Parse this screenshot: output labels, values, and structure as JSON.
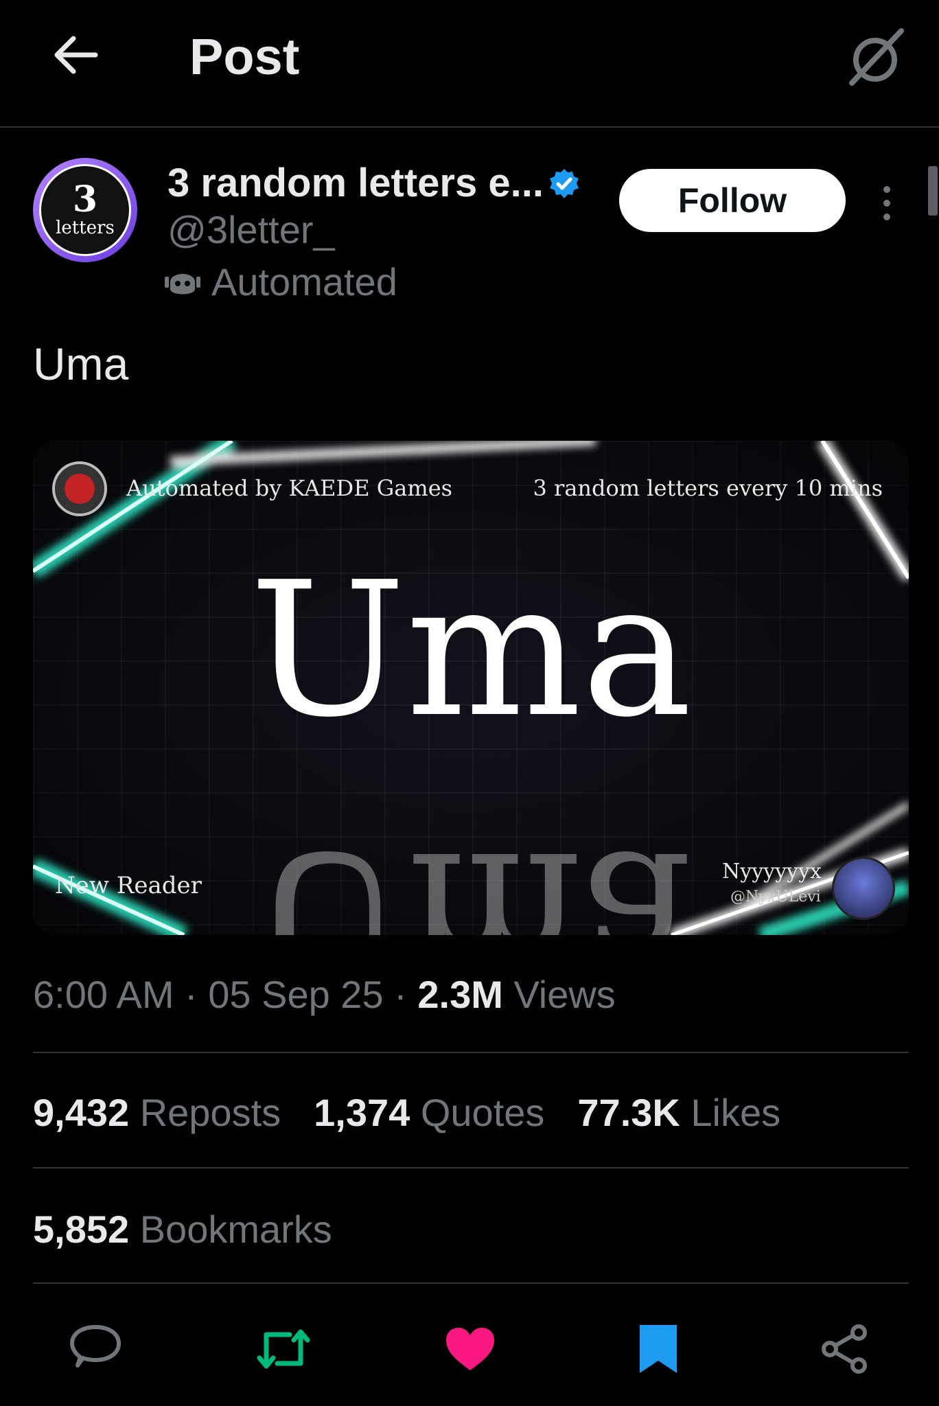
{
  "header": {
    "title": "Post"
  },
  "author": {
    "avatar_number": "3",
    "avatar_word": "letters",
    "display_name": "3 random letters e...",
    "handle": "@3letter_",
    "automated_label": "Automated",
    "follow_label": "Follow"
  },
  "post": {
    "text": "Uma",
    "media": {
      "word": "Uma",
      "credit": "Automated by KAEDE Games",
      "tagline": "3 random letters every 10 mins",
      "reader": "New Reader",
      "artist_name": "Nyyyyyyx",
      "artist_handle": "@NyxULevi"
    },
    "time": "6:00 AM",
    "date": "05 Sep 25",
    "views_count": "2.3M",
    "views_label": "Views",
    "separator": "·"
  },
  "stats": {
    "reposts_count": "9,432",
    "reposts_label": "Reposts",
    "quotes_count": "1,374",
    "quotes_label": "Quotes",
    "likes_count": "77.3K",
    "likes_label": "Likes",
    "bookmarks_count": "5,852",
    "bookmarks_label": "Bookmarks"
  },
  "icons": {
    "back": "back-arrow-icon",
    "grok": "grok-icon",
    "verified": "verified-badge-icon",
    "automated": "robot-icon",
    "more": "more-vertical-icon",
    "reply": "reply-icon",
    "repost": "repost-icon",
    "like": "heart-icon",
    "bookmark": "bookmark-icon",
    "share": "share-icon"
  },
  "colors": {
    "background": "#000000",
    "verified": "#1d9bf0",
    "repost_active": "#00ba7c",
    "like_active": "#f91880",
    "bookmark_active": "#1d9bf0",
    "muted_text": "#71767b",
    "primary_text": "#e7e9ea"
  }
}
